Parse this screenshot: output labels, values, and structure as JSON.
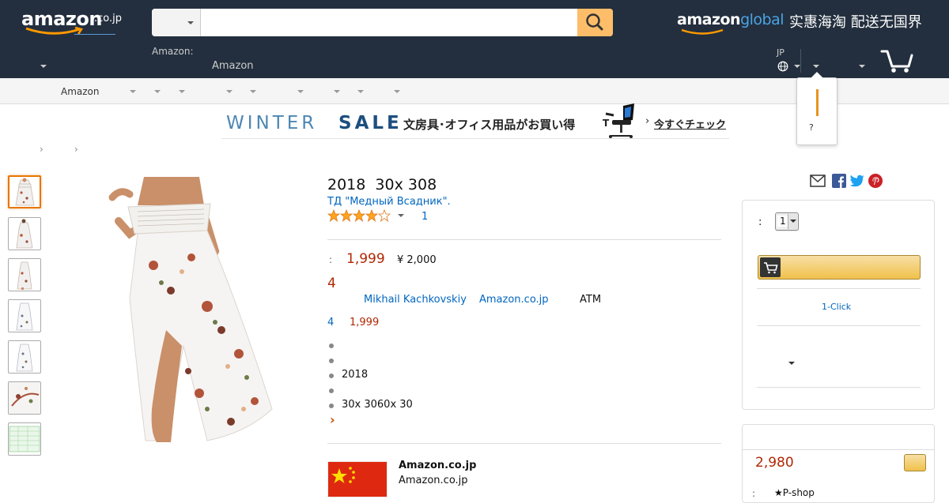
{
  "header": {
    "logo_text": "amazon",
    "logo_suffix": ".co.jp",
    "search_placeholder": "",
    "search_category": "",
    "delivery_label": "Amazon:",
    "amazon_link": "Amazon",
    "global_logo_a": "amazon",
    "global_logo_b": "global",
    "global_tagline": "实惠海淘 配送无国界",
    "lang_code": "JP",
    "popup_text": "?"
  },
  "subnav": {
    "items": [
      "Amazon",
      "",
      "",
      "",
      "",
      "",
      "",
      "",
      ""
    ]
  },
  "banner": {
    "winter": "WINTER",
    "sale": "SALE",
    "jp_text": "文房具･オフィス用品がお買い得",
    "cta": "今すぐチェック"
  },
  "product": {
    "title": "2018  30x 308",
    "brand": "ТД \"Медный Всадник\".",
    "rating_stars": 4,
    "rating_count": "1",
    "price_label": ":",
    "price": "1,999",
    "list_price": "¥ 2,000",
    "points": "4",
    "seller": "Mikhail Kachkovskiy",
    "fulfilled_by": "Amazon.co.jp",
    "payment": "ATM",
    "offers_count": "4",
    "offers_price": "1,999",
    "bullets": [
      "",
      "",
      "2018",
      "",
      "30x 3060x 30"
    ],
    "more": "›",
    "ship_from": "Amazon.co.jp",
    "ship_from_sub": "Amazon.co.jp"
  },
  "buybox": {
    "qty_label": ":",
    "qty_value": "1",
    "oneclick": "1-Click"
  },
  "other_sellers": {
    "price": "2,980",
    "seller_label": ":",
    "seller_name": "★P-shop"
  },
  "colors": {
    "header_bg": "#232f3e",
    "accent_orange": "#febd69",
    "price_red": "#b12704",
    "link_blue": "#0066c0"
  },
  "icons": [
    "cart-icon",
    "search-icon",
    "globe-icon",
    "mail-icon",
    "facebook-icon",
    "twitter-icon",
    "pinterest-icon",
    "star-icon",
    "china-flag-icon"
  ]
}
